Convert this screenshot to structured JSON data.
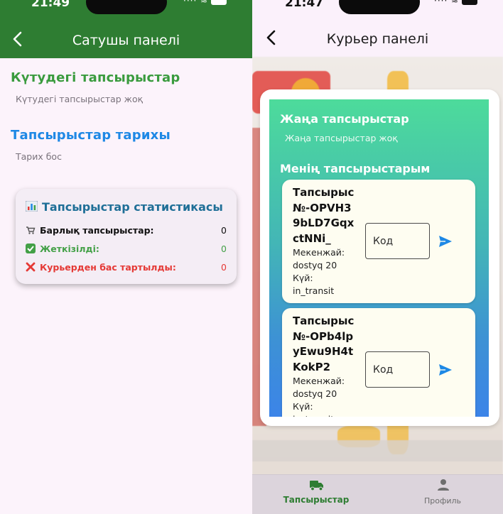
{
  "left_screen": {
    "status": {
      "time": "21:49"
    },
    "header": {
      "title": "Сатушы панелі"
    },
    "pending": {
      "title": "Күтудегі тапсырыстар",
      "empty_text": "Күтудегі тапсырыстар жоқ"
    },
    "history": {
      "title": "Тапсырыстар тарихы",
      "empty_text": "Тарих бос"
    },
    "stats": {
      "title": "Тапсырыстар статистикасы",
      "rows": [
        {
          "label": "Барлық тапсырыстар:",
          "value": "0",
          "icon": "cart-icon",
          "color": "#111111"
        },
        {
          "label": "Жеткізілді:",
          "value": "0",
          "icon": "check-box-icon",
          "color": "#43a047"
        },
        {
          "label": "Курьерден бас тартылды:",
          "value": "0",
          "icon": "cross-mark-icon",
          "color": "#e53935"
        }
      ]
    },
    "colors": {
      "appbar": "#2e7d32",
      "green_title": "#3a9b3e",
      "blue_title": "#1e88e5"
    }
  },
  "right_screen": {
    "status": {
      "time": "21:47"
    },
    "header": {
      "title": "Курьер панелі"
    },
    "new_orders": {
      "title": "Жаңа тапсырыстар",
      "empty_text": "Жаңа тапсырыстар жоқ"
    },
    "my_orders": {
      "title": "Менің тапсырыстарым",
      "orders": [
        {
          "id": "Тапсырыс №-OPVH39bLD7GqxctNNi_",
          "address_label": "Мекенжай:",
          "address": "dostyq 20",
          "status_label": "Күй:",
          "status": "in_transit",
          "code_placeholder": "Код"
        },
        {
          "id": "Тапсырыс №-OPb4lpyEwu9H4tKokP2",
          "address_label": "Мекенжай:",
          "address": "dostyq 20",
          "status_label": "Күй:",
          "status": "in_transit",
          "code_placeholder": "Код"
        }
      ]
    },
    "bottom_nav": [
      {
        "label": "Тапсырыстар",
        "icon": "truck-icon",
        "active": true
      },
      {
        "label": "Профиль",
        "icon": "person-icon",
        "active": false
      }
    ],
    "colors": {
      "accent": "#1e88e5",
      "nav_active": "#2e7d32"
    }
  }
}
